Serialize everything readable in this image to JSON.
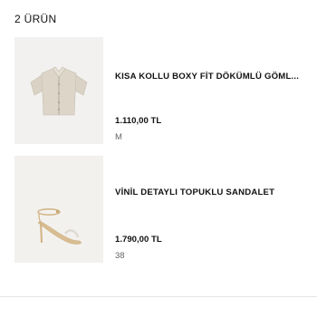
{
  "cart": {
    "item_count_label": "2 ÜRÜN",
    "items": [
      {
        "name": "KISA KOLLU BOXY FİT DÖKÜMLÜ GÖML...",
        "price": "1.110,00 TL",
        "size": "M",
        "image_icon": "shirt-icon"
      },
      {
        "name": "VİNİL DETAYLI TOPUKLU SANDALET",
        "price": "1.790,00 TL",
        "size": "38",
        "image_icon": "sandal-icon"
      }
    ]
  }
}
